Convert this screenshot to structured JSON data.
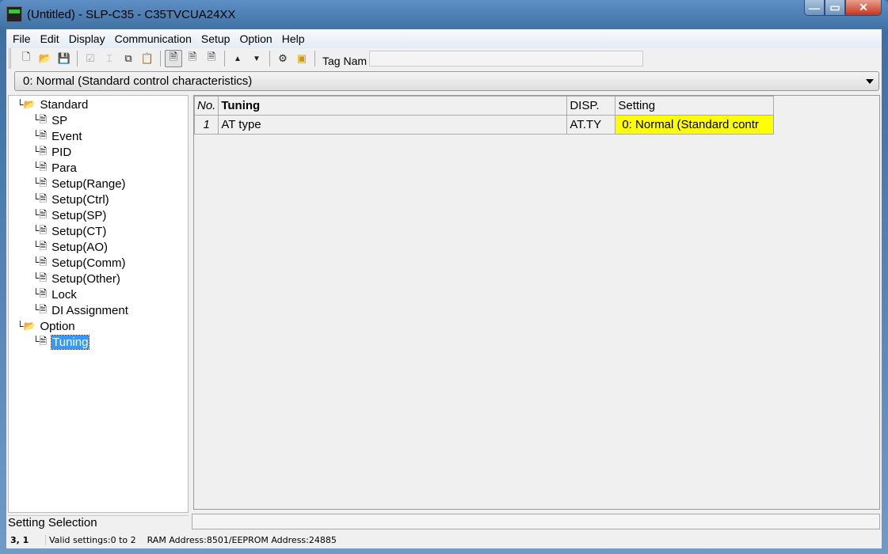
{
  "window": {
    "title": "(Untitled) - SLP-C35 - C35TVCUA24XX",
    "min": "—",
    "max": "▭",
    "close": "✕"
  },
  "menu": [
    "File",
    "Edit",
    "Display",
    "Communication",
    "Setup",
    "Option",
    "Help"
  ],
  "toolbar": {
    "tag_label": "Tag Nam",
    "tag_value": ""
  },
  "combo": {
    "value": "0: Normal (Standard control characteristics)"
  },
  "tree": [
    {
      "label": "Standard",
      "level": 0,
      "icon": "folder-open-icon"
    },
    {
      "label": "SP",
      "level": 1
    },
    {
      "label": "Event",
      "level": 1
    },
    {
      "label": "PID",
      "level": 1
    },
    {
      "label": "Para",
      "level": 1
    },
    {
      "label": "Setup(Range)",
      "level": 1
    },
    {
      "label": "Setup(Ctrl)",
      "level": 1
    },
    {
      "label": "Setup(SP)",
      "level": 1
    },
    {
      "label": "Setup(CT)",
      "level": 1
    },
    {
      "label": "Setup(AO)",
      "level": 1
    },
    {
      "label": "Setup(Comm)",
      "level": 1
    },
    {
      "label": "Setup(Other)",
      "level": 1
    },
    {
      "label": "Lock",
      "level": 1
    },
    {
      "label": "DI Assignment",
      "level": 1
    },
    {
      "label": "Option",
      "level": 0,
      "icon": "folder-open-icon"
    },
    {
      "label": "Tuning",
      "level": 1,
      "selected": true
    }
  ],
  "table": {
    "headers": [
      "No.",
      "Tuning",
      "DISP.",
      "Setting"
    ],
    "rows": [
      [
        "1",
        "AT type",
        "AT.TY",
        "0: Normal (Standard contr"
      ]
    ],
    "highlight_color": "#ffff00"
  },
  "panel_label": "Setting Selection",
  "status": {
    "position": "3, 1",
    "valid": "Valid settings:0 to 2",
    "address": "RAM Address:8501/EEPROM Address:24885"
  }
}
